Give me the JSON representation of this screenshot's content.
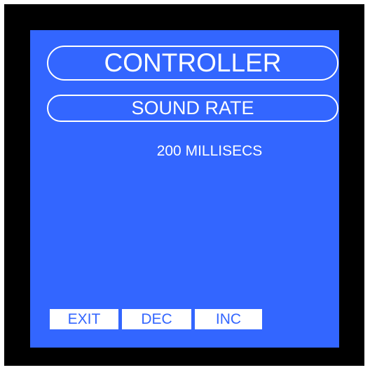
{
  "screen": {
    "title": "CONTROLLER",
    "subtitle": "SOUND RATE",
    "value": "200 MILLISECS"
  },
  "softkeys": {
    "exit": "EXIT",
    "dec": "DEC",
    "inc": "INC"
  },
  "colors": {
    "bezel": "#000000",
    "screen_background": "#3366ff",
    "text": "#ffffff",
    "softkey_background": "#ffffff",
    "softkey_text": "#3366ff"
  }
}
